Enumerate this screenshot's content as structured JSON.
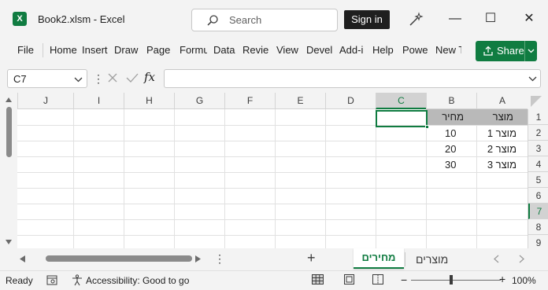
{
  "titlebar": {
    "logo": "X",
    "doc_title": "Book2.xlsm  -  Excel",
    "search_placeholder": "Search",
    "signin_label": "Sign in",
    "minimize_label": "—",
    "maximize_label": "☐",
    "close_label": "✕"
  },
  "ribbon": {
    "tabs": [
      "File",
      "Home",
      "Insert",
      "Draw",
      "Page",
      "Formu",
      "Data",
      "Revie",
      "View",
      "Devel",
      "Add-i",
      "Help",
      "Powe",
      "New T"
    ],
    "share_label": "Share",
    "accent": "#107c41"
  },
  "formula_bar": {
    "name_box_value": "C7",
    "formula_value": "",
    "fx_label": "fx"
  },
  "grid": {
    "columns": [
      "J",
      "I",
      "H",
      "G",
      "F",
      "E",
      "D",
      "C",
      "B",
      "A"
    ],
    "rows": [
      "1",
      "2",
      "3",
      "4",
      "5",
      "6",
      "7",
      "8",
      "9"
    ],
    "selected_column": "C",
    "selected_row": "7",
    "headers": {
      "A": "מוצר",
      "B": "מחיר"
    },
    "data": [
      {
        "A": "מוצר 1",
        "B": "10"
      },
      {
        "A": "מוצר 2",
        "B": "20"
      },
      {
        "A": "מוצר 3",
        "B": "30"
      }
    ]
  },
  "sheets": {
    "add_label": "+",
    "more_label": "⋮",
    "active": "מחירים",
    "other": "מוצרים"
  },
  "status": {
    "ready": "Ready",
    "accessibility": "Accessibility: Good to go",
    "zoom_minus": "−",
    "zoom_plus": "+",
    "zoom": "100%"
  }
}
